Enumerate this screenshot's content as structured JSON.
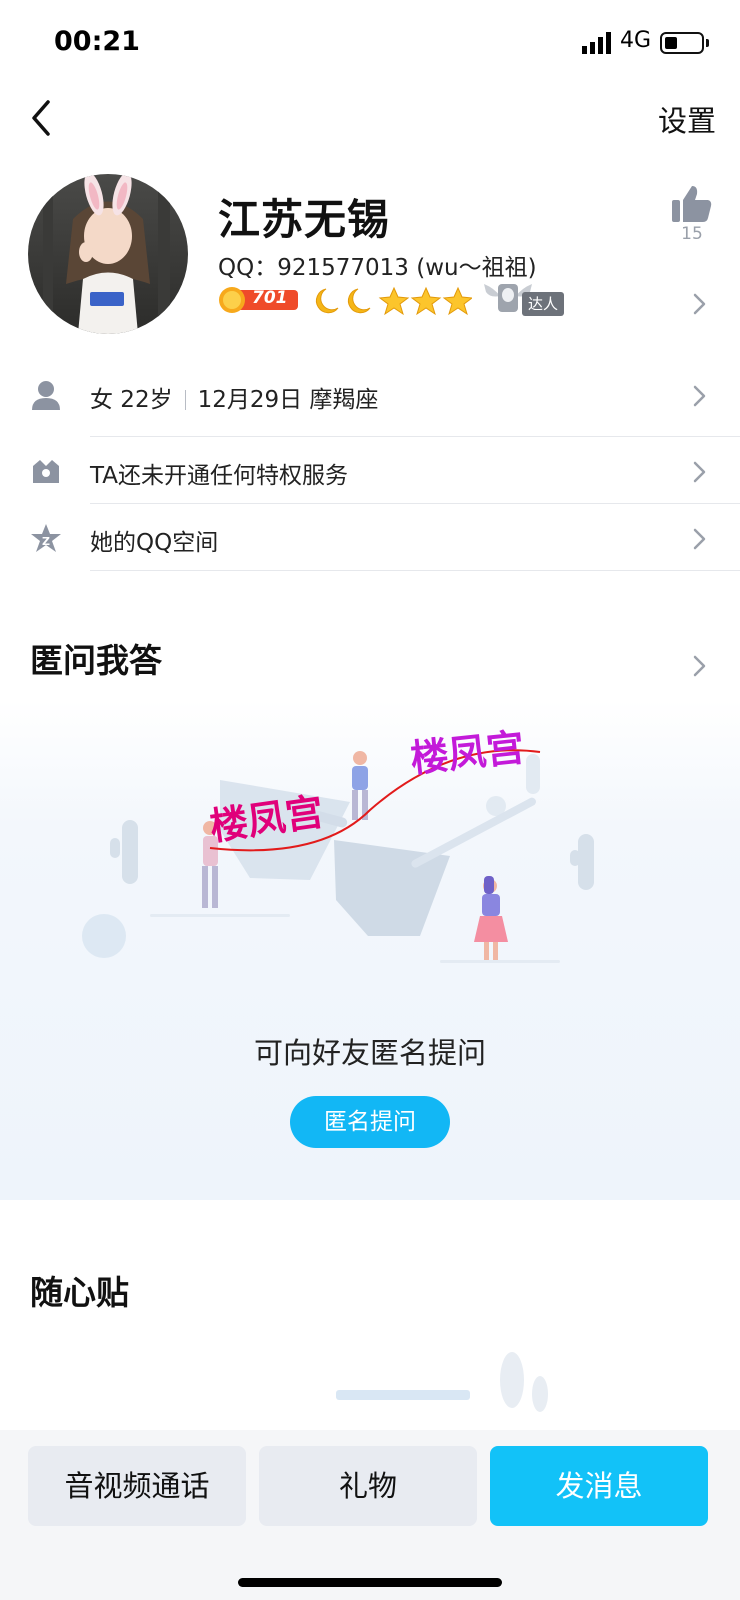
{
  "status_bar": {
    "time": "00:21",
    "network": "4G"
  },
  "nav": {
    "settings_label": "设置"
  },
  "profile": {
    "name": "江苏无锡",
    "qq_line": "QQ：921577013 (wu～祖祖)",
    "level_badge": "701",
    "talent_badge": "达人",
    "likes": "15"
  },
  "info_rows": [
    {
      "gender_age": "女 22岁",
      "birthday": "12月29日 摩羯座"
    },
    {
      "text": "TA还未开通任何特权服务"
    },
    {
      "text": "她的QQ空间"
    }
  ],
  "qa": {
    "title": "匿问我答",
    "prompt": "可向好友匿名提问",
    "button": "匿名提问",
    "watermark": "楼凤宫"
  },
  "notes": {
    "title": "随心贴"
  },
  "actions": {
    "call": "音视频通话",
    "gift": "礼物",
    "message": "发消息"
  },
  "colors": {
    "accent": "#12c2f8",
    "button_bg": "#e8ebf1",
    "watermark": "#e0007a"
  }
}
